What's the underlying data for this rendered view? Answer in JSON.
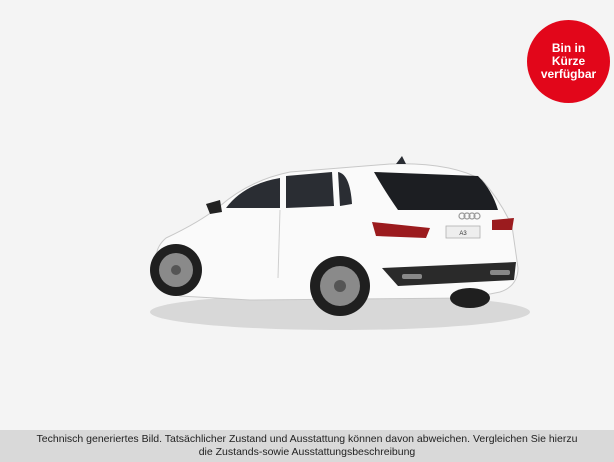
{
  "badge": {
    "line1": "Bin in",
    "line2": "Kürze",
    "line3": "verfügbar",
    "color": "#e2061a"
  },
  "vehicle": {
    "badge_text": "A3",
    "color": "#ffffff"
  },
  "disclaimer": {
    "line1": "Technisch generiertes Bild. Tatsächlicher Zustand und Ausstattung können davon abweichen. Vergleichen Sie hierzu",
    "line2": "die Zustands-sowie Ausstattungsbeschreibung"
  }
}
